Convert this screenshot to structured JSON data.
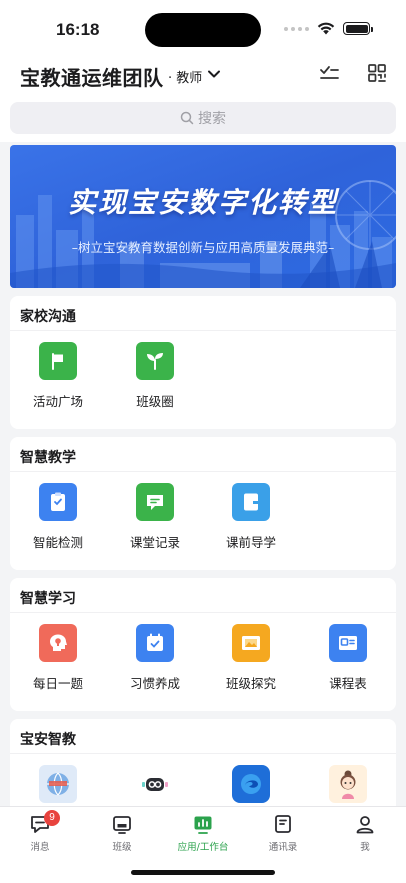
{
  "status": {
    "time": "16:18"
  },
  "header": {
    "title": "宝教通运维团队",
    "role": "· 教师"
  },
  "search": {
    "placeholder": "搜索"
  },
  "banner": {
    "title": "实现宝安数字化转型",
    "subtitle": "–树立宝安教育数据创新与应用高质量发展典范–"
  },
  "sections": [
    {
      "title": "家校沟通",
      "apps": [
        {
          "label": "活动广场",
          "icon": "flag-icon",
          "color": "#3bb34a"
        },
        {
          "label": "班级圈",
          "icon": "sprout-icon",
          "color": "#3bb34a"
        }
      ]
    },
    {
      "title": "智慧教学",
      "apps": [
        {
          "label": "智能检测",
          "icon": "clipboard-icon",
          "color": "#3d82f0"
        },
        {
          "label": "课堂记录",
          "icon": "chat-icon",
          "color": "#3bb34a"
        },
        {
          "label": "课前导学",
          "icon": "book-icon",
          "color": "#3aa0e8"
        }
      ]
    },
    {
      "title": "智慧学习",
      "apps": [
        {
          "label": "每日一题",
          "icon": "bulb-head-icon",
          "color": "#f06a5a"
        },
        {
          "label": "习惯养成",
          "icon": "calendar-check-icon",
          "color": "#3d82f0"
        },
        {
          "label": "班级探究",
          "icon": "picture-icon",
          "color": "#f5a820"
        },
        {
          "label": "课程表",
          "icon": "schedule-icon",
          "color": "#3d82f0"
        }
      ]
    },
    {
      "title": "宝安智教",
      "apps": [
        {
          "icon": "globe-logo-icon"
        },
        {
          "icon": "robot-icon"
        },
        {
          "icon": "edge-icon"
        },
        {
          "icon": "avatar-girl-icon"
        }
      ]
    }
  ],
  "tabbar": [
    {
      "label": "消息",
      "badge": "9",
      "icon": "message-icon"
    },
    {
      "label": "班级",
      "icon": "class-icon"
    },
    {
      "label": "应用/工作台",
      "icon": "workbench-icon",
      "active": true
    },
    {
      "label": "通讯录",
      "icon": "contacts-icon"
    },
    {
      "label": "我",
      "icon": "profile-icon"
    }
  ]
}
